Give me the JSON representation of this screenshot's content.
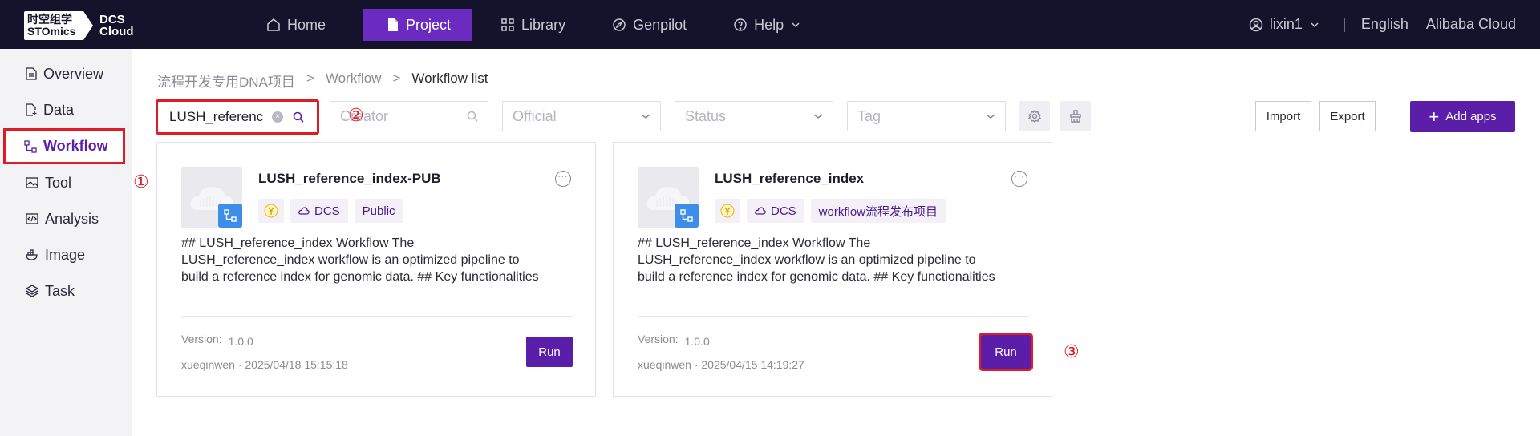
{
  "brand": {
    "logo_line1": "时空组学",
    "logo_line2": "STOmics",
    "product_line1": "DCS",
    "product_line2": "Cloud"
  },
  "nav": {
    "items": [
      {
        "label": "Home",
        "icon": "home-icon"
      },
      {
        "label": "Project",
        "icon": "document-icon",
        "active": true
      },
      {
        "label": "Library",
        "icon": "grid-icon"
      },
      {
        "label": "Genpilot",
        "icon": "compass-icon"
      },
      {
        "label": "Help",
        "icon": "help-circle-icon",
        "has_dropdown": true
      }
    ],
    "user": "lixin1",
    "language": "English",
    "region": "Alibaba Cloud"
  },
  "sidebar": {
    "items": [
      {
        "label": "Overview",
        "icon": "document-icon"
      },
      {
        "label": "Data",
        "icon": "file-add-icon"
      },
      {
        "label": "Workflow",
        "icon": "workflow-icon",
        "active": true
      },
      {
        "label": "Tool",
        "icon": "image-icon"
      },
      {
        "label": "Analysis",
        "icon": "code-icon"
      },
      {
        "label": "Image",
        "icon": "docker-icon"
      },
      {
        "label": "Task",
        "icon": "layers-icon"
      }
    ]
  },
  "annotations": {
    "m1": "①",
    "m2": "②",
    "m3": "③"
  },
  "breadcrumb": {
    "project": "流程开发专用DNA项目",
    "section": "Workflow",
    "current": "Workflow list",
    "separator": ">"
  },
  "filters": {
    "search_value": "LUSH_referenc",
    "creator_placeholder": "Creator",
    "official_placeholder": "Official",
    "status_placeholder": "Status",
    "tag_placeholder": "Tag"
  },
  "actions": {
    "import": "Import",
    "export": "Export",
    "add_apps": "Add apps"
  },
  "colors": {
    "primary": "#5b1ea8",
    "nav_bg": "#14132b",
    "highlight": "#e01b24",
    "badge_blue": "#3d8ee8"
  },
  "cards": [
    {
      "title": "LUSH_reference_index-PUB",
      "tags": [
        "DCS",
        "Public"
      ],
      "desc_line1": "## LUSH_reference_index Workflow The",
      "desc_line2": "LUSH_reference_index workflow is an optimized pipeline to",
      "desc_line3": "build a reference index for genomic data. ## Key functionalities",
      "version_label": "Version:",
      "version": "1.0.0",
      "meta": "xueqinwen · 2025/04/18 15:15:18",
      "run": "Run"
    },
    {
      "title": "LUSH_reference_index",
      "tags": [
        "DCS",
        "workflow流程发布项目"
      ],
      "desc_line1": "## LUSH_reference_index Workflow The",
      "desc_line2": "LUSH_reference_index workflow is an optimized pipeline to",
      "desc_line3": "build a reference index for genomic data. ## Key functionalities",
      "version_label": "Version:",
      "version": "1.0.0",
      "meta": "xueqinwen · 2025/04/15 14:19:27",
      "run": "Run"
    }
  ]
}
